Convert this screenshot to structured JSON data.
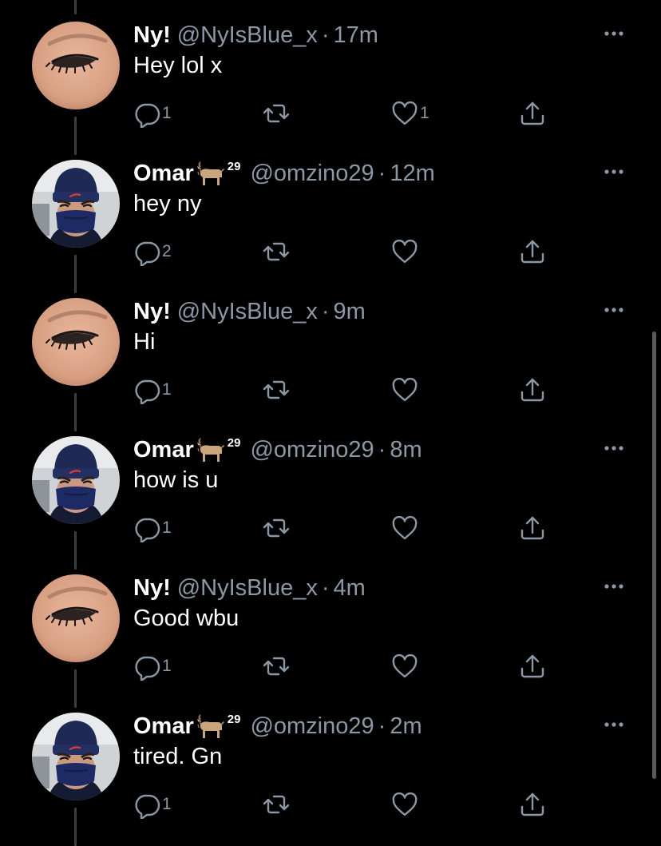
{
  "colors": {
    "background": "#000000",
    "text": "#ffffff",
    "muted": "#8b98a5",
    "thread_line": "#3a3f44"
  },
  "tweets": [
    {
      "author": "ny",
      "name": "Ny!",
      "badge": "",
      "handle": "@NyIsBlue_x",
      "time": "17m",
      "text": "Hey lol x",
      "replies": "1",
      "retweets": "",
      "likes": "1",
      "liked_icon": "heart-outline-icon"
    },
    {
      "author": "omar",
      "name": "Omar",
      "badge": "29",
      "handle": "@omzino29",
      "time": "12m",
      "text": "hey ny",
      "replies": "2",
      "retweets": "",
      "likes": ""
    },
    {
      "author": "ny",
      "name": "Ny!",
      "badge": "",
      "handle": "@NyIsBlue_x",
      "time": "9m",
      "text": "Hi",
      "replies": "1",
      "retweets": "",
      "likes": ""
    },
    {
      "author": "omar",
      "name": "Omar",
      "badge": "29",
      "handle": "@omzino29",
      "time": "8m",
      "text": "how is u",
      "replies": "1",
      "retweets": "",
      "likes": ""
    },
    {
      "author": "ny",
      "name": "Ny!",
      "badge": "",
      "handle": "@NyIsBlue_x",
      "time": "4m",
      "text": "Good wbu",
      "replies": "1",
      "retweets": "",
      "likes": ""
    },
    {
      "author": "omar",
      "name": "Omar",
      "badge": "29",
      "handle": "@omzino29",
      "time": "2m",
      "text": "tired. Gn",
      "replies": "1",
      "retweets": "",
      "likes": ""
    }
  ],
  "separator": "·",
  "icons": {
    "reply": "reply-icon",
    "retweet": "retweet-icon",
    "like": "heart-icon",
    "share": "share-icon",
    "more": "more-options-icon",
    "goat": "goat-emoji-icon"
  }
}
